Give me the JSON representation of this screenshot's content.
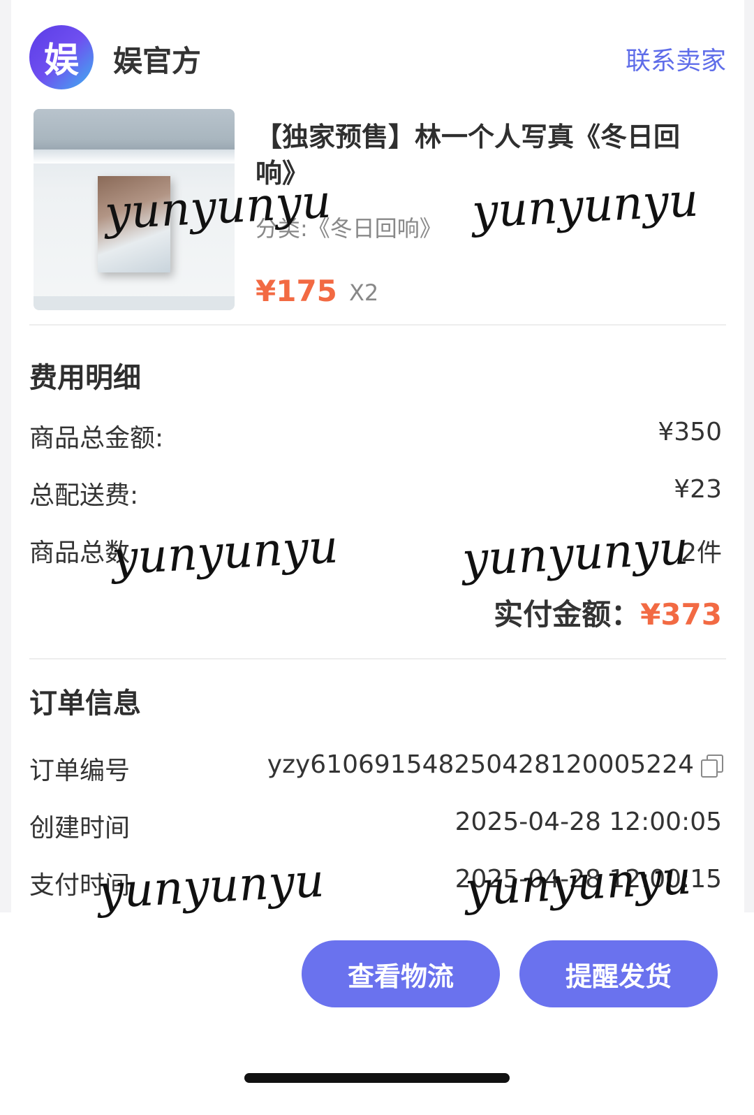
{
  "shop": {
    "logo_glyph": "娱",
    "name": "娱官方",
    "contact_label": "联系卖家"
  },
  "product": {
    "title": "【独家预售】林一个人写真《冬日回响》",
    "spec": "分类:《冬日回响》",
    "price": "¥175",
    "quantity": "X2"
  },
  "fees": {
    "section_title": "费用明细",
    "rows": [
      {
        "label": "商品总金额:",
        "value": "¥350"
      },
      {
        "label": "总配送费:",
        "value": "¥23"
      },
      {
        "label": "商品总数",
        "value": "2件"
      }
    ],
    "total_label": "实付金额：",
    "total_value": "¥373"
  },
  "order": {
    "section_title": "订单信息",
    "rows": [
      {
        "label": "订单编号",
        "value": "yzy610691548250428120005224"
      },
      {
        "label": "创建时间",
        "value": "2025-04-28 12:00:05"
      },
      {
        "label": "支付时间",
        "value": "2025-04-28 12:00:15"
      }
    ]
  },
  "actions": {
    "view_logistics": "查看物流",
    "remind_shipping": "提醒发货"
  },
  "watermark": "yunyunyu",
  "colors": {
    "accent": "#6a72ee",
    "price": "#f26a43",
    "link": "#5f6de9"
  }
}
